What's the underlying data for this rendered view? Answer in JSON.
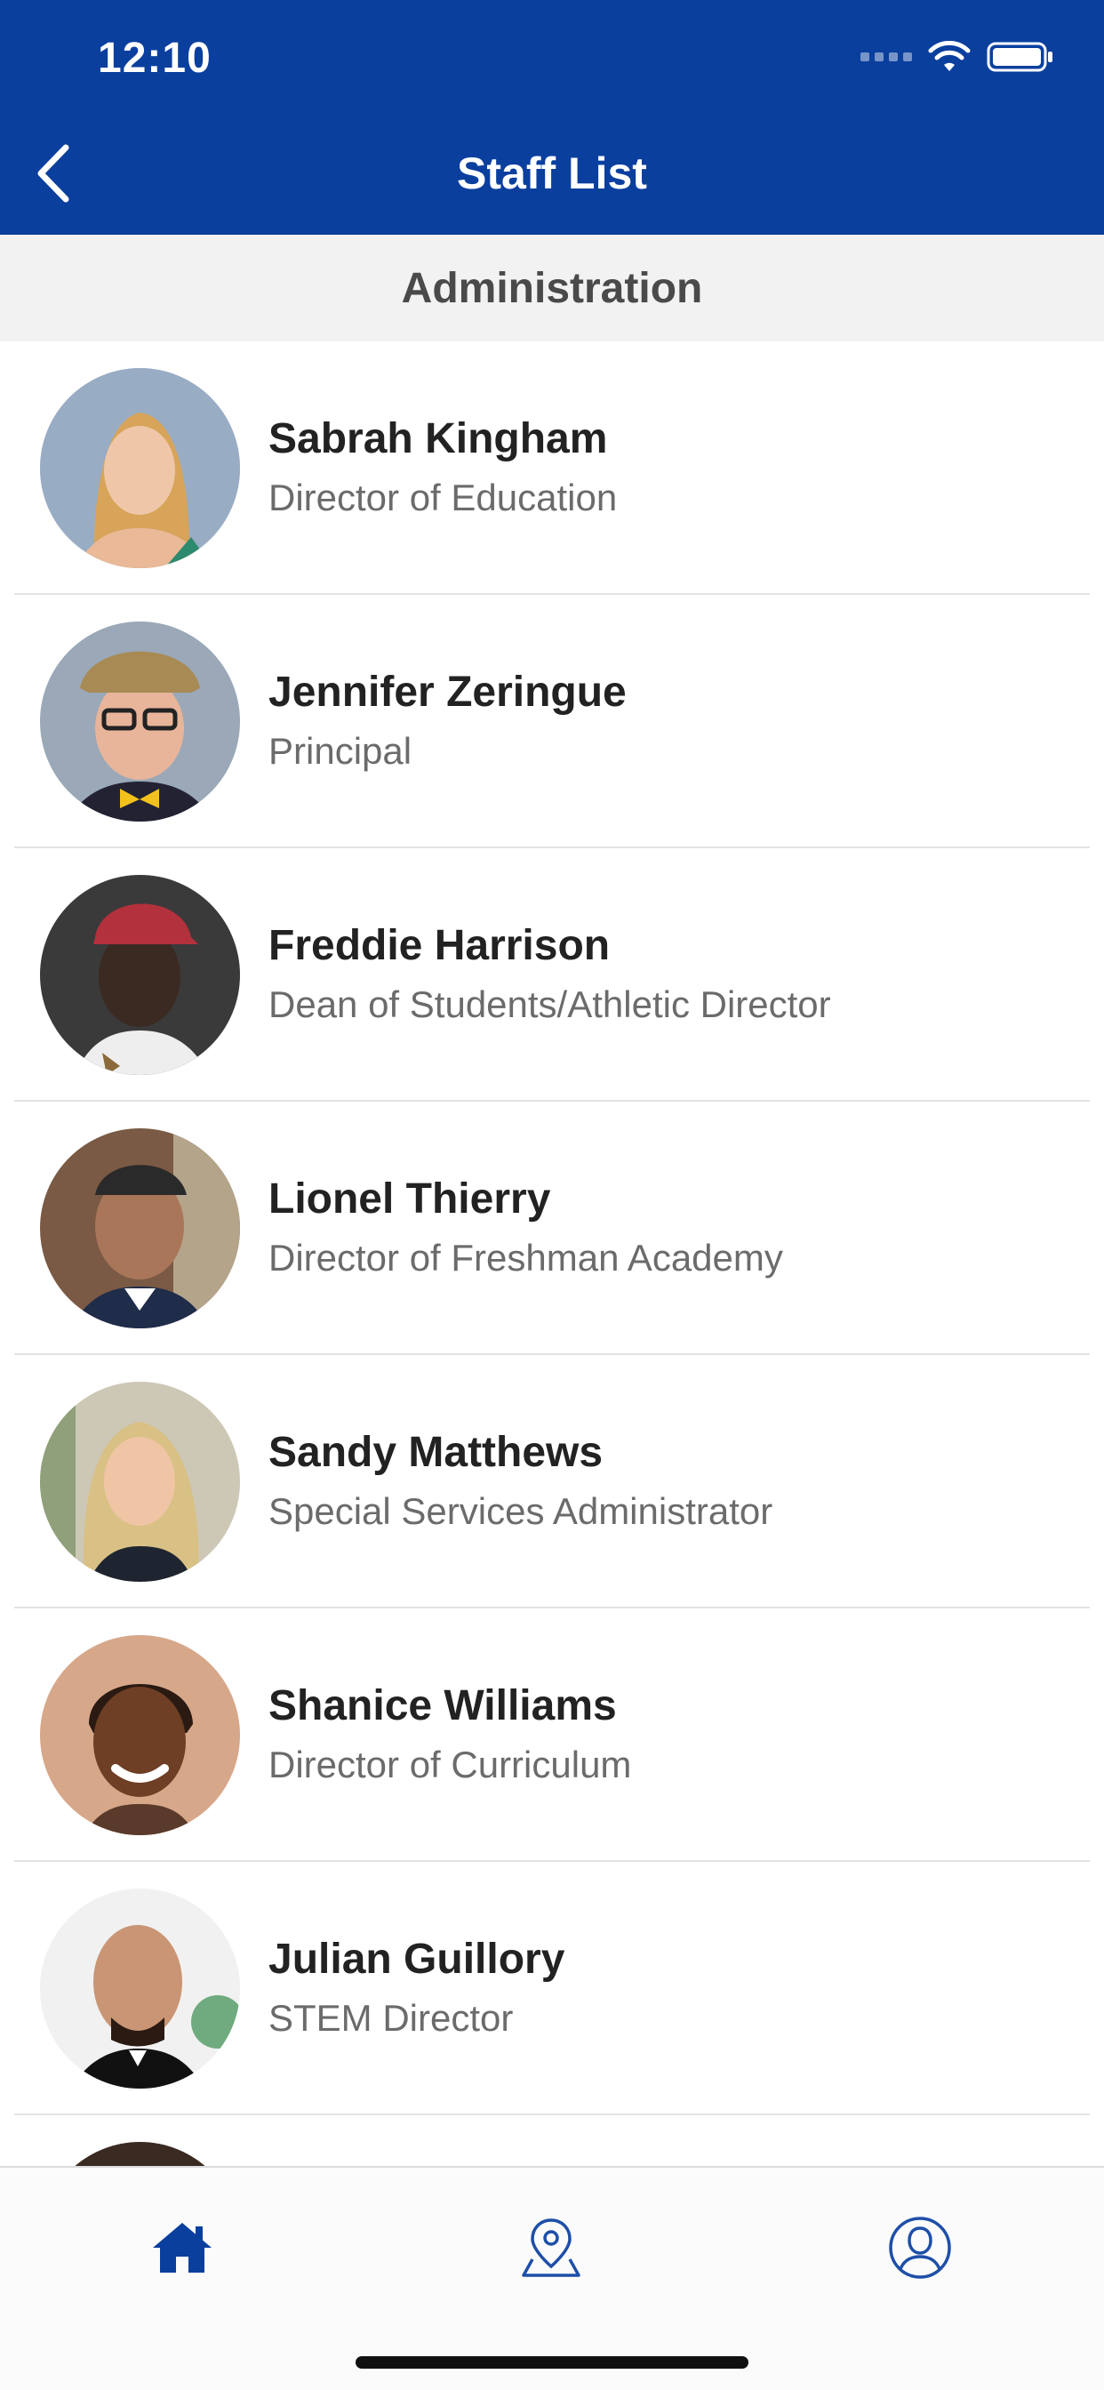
{
  "status_bar": {
    "time": "12:10"
  },
  "nav": {
    "title": "Staff List"
  },
  "section": {
    "title": "Administration"
  },
  "staff": [
    {
      "name": "Sabrah Kingham",
      "role": "Director of Education"
    },
    {
      "name": "Jennifer Zeringue",
      "role": "Principal"
    },
    {
      "name": "Freddie Harrison",
      "role": "Dean of Students/Athletic Director"
    },
    {
      "name": "Lionel Thierry",
      "role": "Director of Freshman Academy"
    },
    {
      "name": "Sandy Matthews",
      "role": "Special Services Administrator"
    },
    {
      "name": "Shanice Williams",
      "role": "Director of Curriculum"
    },
    {
      "name": "Julian Guillory",
      "role": "STEM Director"
    }
  ],
  "tabs": [
    {
      "icon": "home-icon",
      "active": true
    },
    {
      "icon": "map-pin-icon",
      "active": false
    },
    {
      "icon": "profile-icon",
      "active": false
    }
  ],
  "colors": {
    "brand": "#0a3f9e",
    "section_bg": "#f2f2f2",
    "tab_inactive": "#1e4fa8"
  }
}
